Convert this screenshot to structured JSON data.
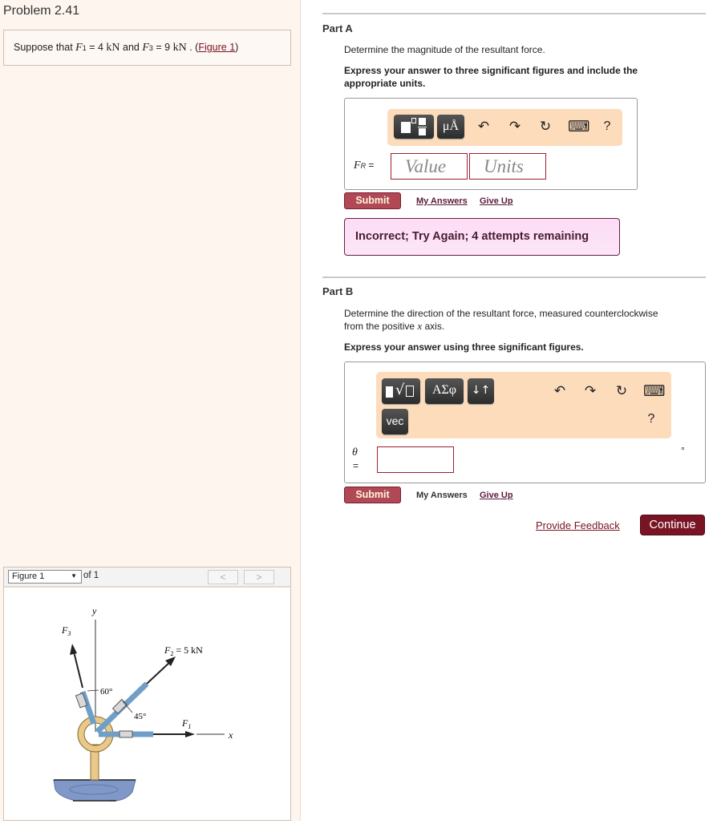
{
  "problem": {
    "title": "Problem 2.41",
    "statement": {
      "prefix": "Suppose that ",
      "f1_symbol": "F",
      "f1_sub": "1",
      "f1_eq": " = 4 ",
      "f1_unit": "kN",
      "mid": " and ",
      "f3_symbol": "F",
      "f3_sub": "3",
      "f3_eq": " = 9 ",
      "f3_unit": "kN",
      "suffix_before_link": " . (",
      "figure_link": "Figure 1",
      "suffix": ")"
    }
  },
  "figure_nav": {
    "selected": "Figure 1",
    "of_label": "of 1",
    "prev": "<",
    "next": ">"
  },
  "figure": {
    "y_label": "y",
    "x_label": "x",
    "f3_label": "F",
    "f3_sub": "3",
    "f2_label": "F",
    "f2_sub": "2",
    "f2_value": " = 5 kN",
    "f1_label": "F",
    "f1_sub": "1",
    "angle1": "60°",
    "angle2": "45°",
    "colors": {
      "rope": "#6f9fc8",
      "ring": "#e8c98a",
      "base": "#7f98c8"
    }
  },
  "partA": {
    "label": "Part A",
    "question": "Determine the magnitude of the resultant force.",
    "instruction": "Express your answer to three significant figures and include the appropriate units.",
    "toolbar": {
      "template_icon": "fraction-template-icon",
      "units_btn": "μÅ",
      "undo": "↶",
      "redo": "↷",
      "reset": "↻",
      "keyboard": "⌨",
      "help": "?"
    },
    "var_symbol": "F",
    "var_sub": "R",
    "var_eq": " =",
    "value_placeholder": "Value",
    "units_placeholder": "Units",
    "submit": "Submit",
    "my_answers": "My Answers",
    "give_up": "Give Up",
    "feedback": "Incorrect; Try Again; 4 attempts remaining"
  },
  "partB": {
    "label": "Part B",
    "question_line1": "Determine the direction of the resultant force, measured counterclockwise",
    "question_line2_pre": "from the positive ",
    "question_x": "x",
    "question_line2_post": " axis.",
    "instruction": "Express your answer using three significant figures.",
    "toolbar": {
      "template_icon": "radical-template-icon",
      "greek_btn": "ΑΣφ",
      "arrows_btn": "↓↑",
      "vec_btn": "vec",
      "undo": "↶",
      "redo": "↷",
      "reset": "↻",
      "keyboard": "⌨",
      "help": "?"
    },
    "var_symbol": "θ",
    "var_eq": "=",
    "unit": "°",
    "submit": "Submit",
    "my_answers": "My Answers",
    "give_up": "Give Up"
  },
  "footer": {
    "provide_feedback": "Provide Feedback",
    "continue": "Continue"
  }
}
